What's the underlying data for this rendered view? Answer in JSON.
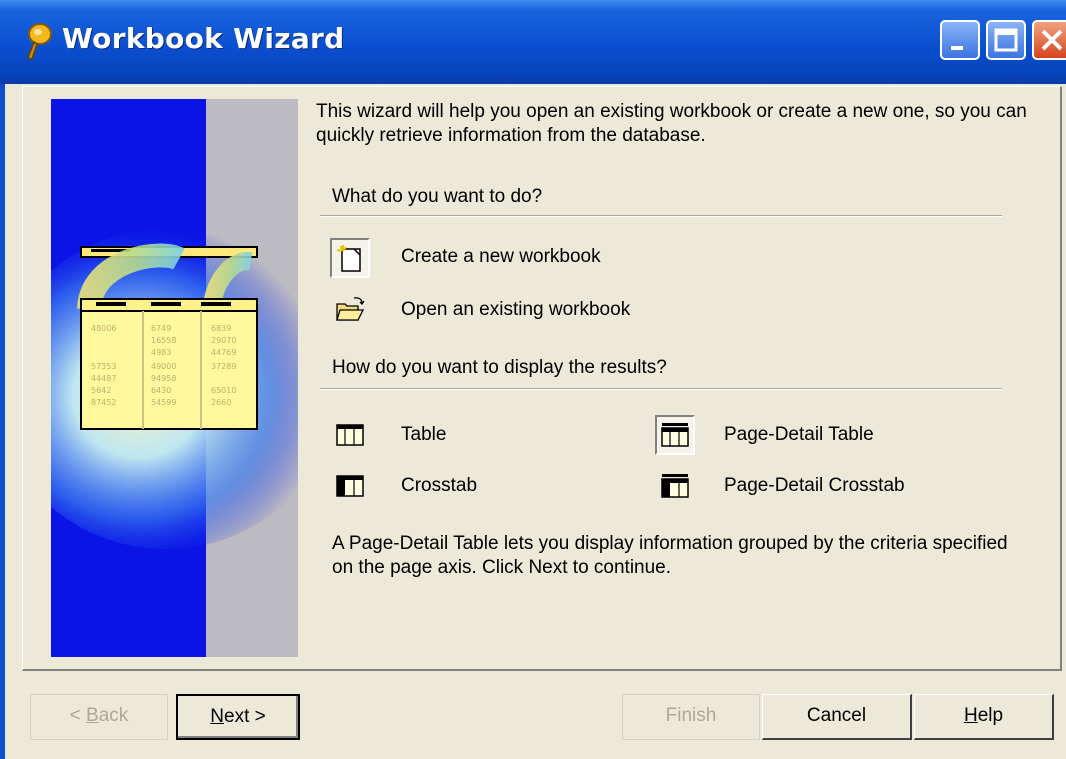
{
  "window": {
    "title": "Workbook Wizard"
  },
  "intro": "This wizard will help you open an existing workbook or create a new one, so you can quickly retrieve information from the database.",
  "section1": {
    "question": "What do you want to do?",
    "options": [
      {
        "label": "Create a new workbook",
        "icon": "new-workbook-icon",
        "selected": true
      },
      {
        "label": "Open an existing workbook",
        "icon": "open-folder-icon",
        "selected": false
      }
    ]
  },
  "section2": {
    "question": "How do you want to display the results?",
    "options": [
      {
        "label": "Table",
        "icon": "table-icon",
        "selected": false
      },
      {
        "label": "Page-Detail Table",
        "icon": "page-detail-table-icon",
        "selected": true
      },
      {
        "label": "Crosstab",
        "icon": "crosstab-icon",
        "selected": false
      },
      {
        "label": "Page-Detail Crosstab",
        "icon": "page-detail-crosstab-icon",
        "selected": false
      }
    ]
  },
  "description": "A Page-Detail Table lets you display information grouped by the criteria specified on the page axis. Click Next to continue.",
  "illustration": {
    "numbers": [
      [
        "48006",
        "6749",
        "6839",
        "16558",
        "29070",
        "4983",
        "44769",
        "57353",
        "49000",
        "37289",
        "44487",
        "94958",
        "5642",
        "6430",
        "65010",
        "87452",
        "54599",
        "2660"
      ]
    ]
  },
  "buttons": {
    "back": {
      "prefix": "< ",
      "key": "B",
      "rest": "ack",
      "enabled": false
    },
    "next": {
      "key": "N",
      "rest": "ext >",
      "enabled": true
    },
    "finish": {
      "label": "Finish",
      "enabled": false
    },
    "cancel": {
      "label": "Cancel",
      "enabled": true
    },
    "help": {
      "key": "H",
      "rest": "elp",
      "enabled": true
    }
  },
  "colors": {
    "titlebar": "#0a4fd0",
    "illustration_blue": "#0a14e6",
    "dialog_bg": "#ece9d8"
  }
}
